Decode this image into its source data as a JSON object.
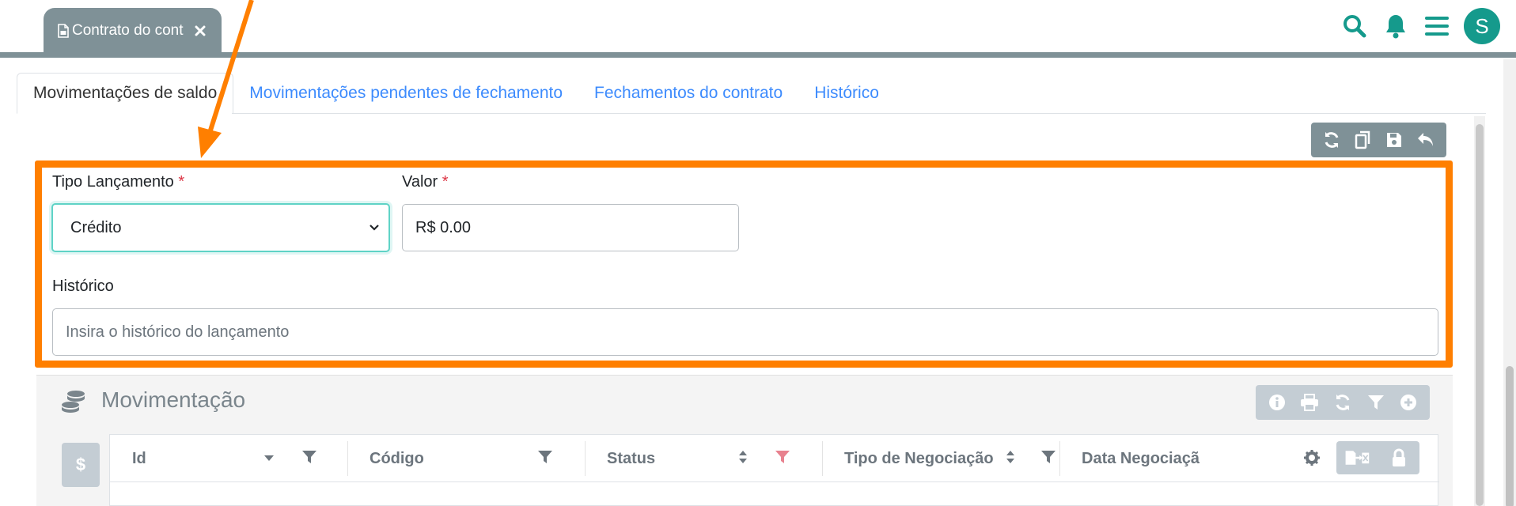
{
  "header": {
    "document_tab_label": "Contrato do cont",
    "avatar_initial": "S"
  },
  "tabs": [
    {
      "label": "Movimentações de saldo",
      "active": true
    },
    {
      "label": "Movimentações pendentes de fechamento",
      "active": false
    },
    {
      "label": "Fechamentos do contrato",
      "active": false
    },
    {
      "label": "Histórico",
      "active": false
    }
  ],
  "form": {
    "tipo_label": "Tipo Lançamento",
    "tipo_value": "Crédito",
    "valor_label": "Valor",
    "valor_value": "R$ 0.00",
    "required_mark": "*",
    "historico_label": "Histórico",
    "historico_placeholder": "Insira o histórico do lançamento"
  },
  "panel": {
    "title": "Movimentação",
    "dollar_label": "$",
    "columns": [
      "Id",
      "Código",
      "Status",
      "Tipo de Negociação",
      "Data Negociaçã"
    ]
  },
  "colors": {
    "accent": "#159a8c",
    "highlight": "#ff7f00",
    "tab_link": "#3d8bfd",
    "toolbar": "#7f9197"
  }
}
